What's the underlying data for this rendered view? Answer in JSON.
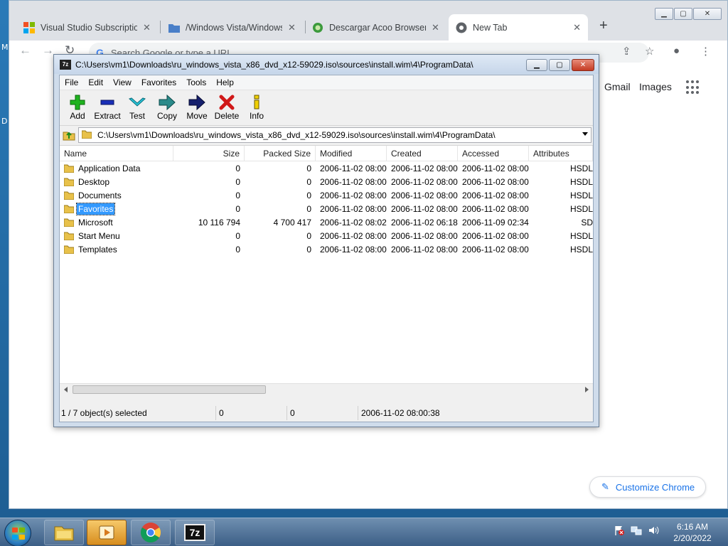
{
  "desktop": {
    "fragments": [
      "M",
      "D"
    ]
  },
  "chrome": {
    "tabs": [
      {
        "title": "Visual Studio Subscriptions",
        "icon": "microsoft-logo-icon"
      },
      {
        "title": "/Windows Vista/Windows",
        "icon": "folder-icon"
      },
      {
        "title": "Descargar Acoo Browser gratis",
        "icon": "acoo-browser-icon"
      },
      {
        "title": "New Tab",
        "icon": "chrome-icon"
      }
    ],
    "omnibox_placeholder": "Search Google or type a URL",
    "links": {
      "gmail": "Gmail",
      "images": "Images"
    },
    "customize_label": "Customize Chrome"
  },
  "sevenzip": {
    "title": "C:\\Users\\vm1\\Downloads\\ru_windows_vista_x86_dvd_x12-59029.iso\\sources\\install.wim\\4\\ProgramData\\",
    "menu": [
      "File",
      "Edit",
      "View",
      "Favorites",
      "Tools",
      "Help"
    ],
    "toolbar": [
      {
        "label": "Add",
        "icon": "add-icon"
      },
      {
        "label": "Extract",
        "icon": "extract-icon"
      },
      {
        "label": "Test",
        "icon": "test-icon"
      },
      {
        "label": "Copy",
        "icon": "copy-icon"
      },
      {
        "label": "Move",
        "icon": "move-icon"
      },
      {
        "label": "Delete",
        "icon": "delete-icon"
      },
      {
        "label": "Info",
        "icon": "info-icon"
      }
    ],
    "address": "C:\\Users\\vm1\\Downloads\\ru_windows_vista_x86_dvd_x12-59029.iso\\sources\\install.wim\\4\\ProgramData\\",
    "columns": [
      "Name",
      "Size",
      "Packed Size",
      "Modified",
      "Created",
      "Accessed",
      "Attributes"
    ],
    "rows": [
      {
        "name": "Application Data",
        "size": "0",
        "packed": "0",
        "modified": "2006-11-02 08:00",
        "created": "2006-11-02 08:00",
        "accessed": "2006-11-02 08:00",
        "attr": "HSDL"
      },
      {
        "name": "Desktop",
        "size": "0",
        "packed": "0",
        "modified": "2006-11-02 08:00",
        "created": "2006-11-02 08:00",
        "accessed": "2006-11-02 08:00",
        "attr": "HSDL"
      },
      {
        "name": "Documents",
        "size": "0",
        "packed": "0",
        "modified": "2006-11-02 08:00",
        "created": "2006-11-02 08:00",
        "accessed": "2006-11-02 08:00",
        "attr": "HSDL"
      },
      {
        "name": "Favorites",
        "size": "0",
        "packed": "0",
        "modified": "2006-11-02 08:00",
        "created": "2006-11-02 08:00",
        "accessed": "2006-11-02 08:00",
        "attr": "HSDL",
        "selected": true
      },
      {
        "name": "Microsoft",
        "size": "10 116 794",
        "packed": "4 700 417",
        "modified": "2006-11-02 08:02",
        "created": "2006-11-02 06:18",
        "accessed": "2006-11-09 02:34",
        "attr": "SD"
      },
      {
        "name": "Start Menu",
        "size": "0",
        "packed": "0",
        "modified": "2006-11-02 08:00",
        "created": "2006-11-02 08:00",
        "accessed": "2006-11-02 08:00",
        "attr": "HSDL"
      },
      {
        "name": "Templates",
        "size": "0",
        "packed": "0",
        "modified": "2006-11-02 08:00",
        "created": "2006-11-02 08:00",
        "accessed": "2006-11-02 08:00",
        "attr": "HSDL"
      }
    ],
    "status": {
      "selection": "1 / 7 object(s) selected",
      "size": "0",
      "packed": "0",
      "modified": "2006-11-02 08:00:38"
    }
  },
  "taskbar": {
    "apps": [
      {
        "name": "explorer-icon"
      },
      {
        "name": "media-player-icon"
      },
      {
        "name": "chrome-icon"
      },
      {
        "name": "7zip-icon",
        "label": "7z"
      }
    ],
    "clock": {
      "time": "6:16 AM",
      "date": "2/20/2022"
    }
  }
}
